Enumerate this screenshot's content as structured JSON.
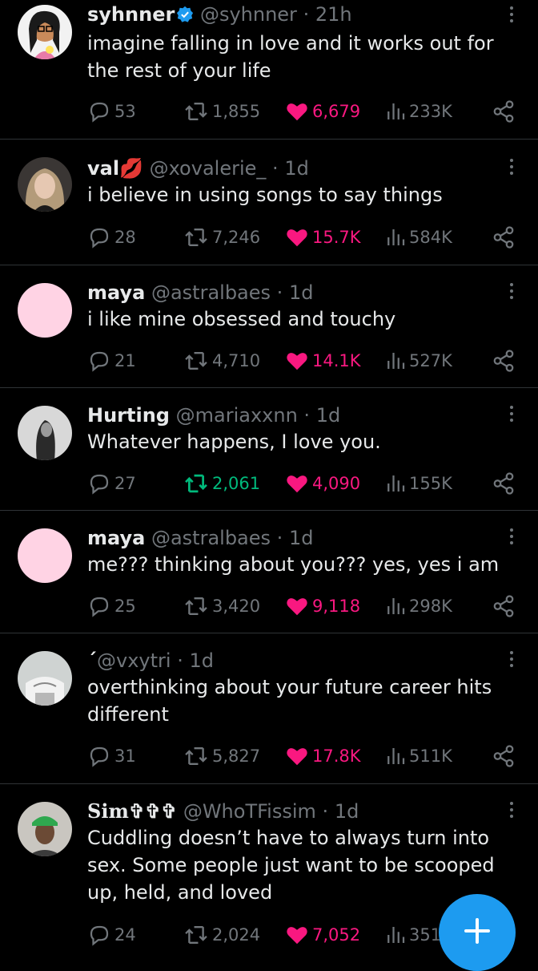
{
  "tweets": [
    {
      "name": "syhnner",
      "verified": true,
      "handle": "@syhnner",
      "dot": "·",
      "time": "21h",
      "text": "imagine falling in love and it works out for the rest of your life",
      "replies": "53",
      "reposts": "1,855",
      "likes": "6,679",
      "views": "233K",
      "liked": true,
      "reposted": false,
      "avatar": "cartoon-girl"
    },
    {
      "name": "val💋",
      "verified": false,
      "handle": "@xovalerie_",
      "dot": "·",
      "time": "1d",
      "text": "i believe in using songs to say things",
      "replies": "28",
      "reposts": "7,246",
      "likes": "15.7K",
      "views": "584K",
      "liked": true,
      "reposted": false,
      "avatar": "photo"
    },
    {
      "name": "maya",
      "verified": false,
      "handle": "@astralbaes",
      "dot": "·",
      "time": "1d",
      "text": "i like mine obsessed and touchy",
      "replies": "21",
      "reposts": "4,710",
      "likes": "14.1K",
      "views": "527K",
      "liked": true,
      "reposted": false,
      "avatar": "pink"
    },
    {
      "name": "Hurting",
      "verified": false,
      "handle": "@mariaxxnn",
      "dot": "·",
      "time": "1d",
      "text": "Whatever happens, I love you.",
      "replies": "27",
      "reposts": "2,061",
      "likes": "4,090",
      "views": "155K",
      "liked": true,
      "reposted": true,
      "avatar": "bw-photo"
    },
    {
      "name": "maya",
      "verified": false,
      "handle": "@astralbaes",
      "dot": "·",
      "time": "1d",
      "text": "me??? thinking about you??? yes, yes i am",
      "replies": "25",
      "reposts": "3,420",
      "likes": "9,118",
      "views": "298K",
      "liked": true,
      "reposted": false,
      "avatar": "pink"
    },
    {
      "name": "ˊ",
      "verified": false,
      "handle": "@vxytri",
      "dot": "·",
      "time": "1d",
      "text": "overthinking about your future career hits different",
      "replies": "31",
      "reposts": "5,827",
      "likes": "17.8K",
      "views": "511K",
      "liked": true,
      "reposted": false,
      "avatar": "photo-light"
    },
    {
      "name": "Sim✞✞✞",
      "verified": false,
      "handle": "@WhoTFissim",
      "dot": "·",
      "time": "1d",
      "text": "Cuddling doesn’t have to always turn into sex. Some people just want to be scooped up, held, and loved",
      "replies": "24",
      "reposts": "2,024",
      "likes": "7,052",
      "views": "351",
      "liked": true,
      "reposted": false,
      "avatar": "photo-green"
    }
  ],
  "colors": {
    "accent": "#1d9bf0",
    "like": "#f91880",
    "repost": "#00ba7c",
    "muted": "#71767b",
    "text": "#e7e9ea",
    "divider": "#2f3336"
  },
  "icons": {
    "reply": "reply-icon",
    "repost": "repost-icon",
    "like": "heart-icon",
    "views": "views-icon",
    "share": "share-icon",
    "more": "more-icon",
    "compose": "plus-icon"
  }
}
